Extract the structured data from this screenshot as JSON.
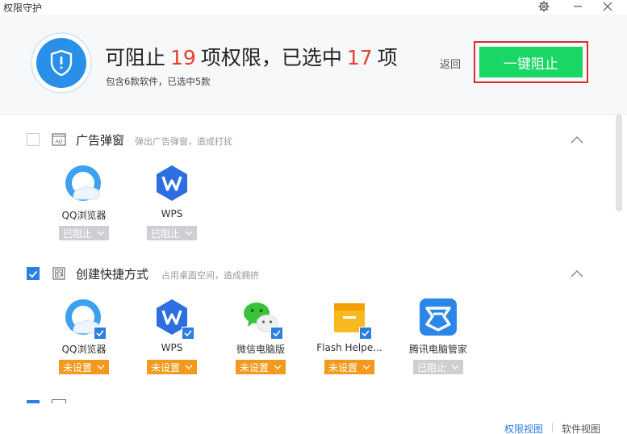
{
  "window": {
    "title": "权限守护"
  },
  "header": {
    "main_prefix": "可阻止",
    "blockable_count": "19",
    "main_middle": "项权限，已选中",
    "selected_count": "17",
    "main_suffix": "项",
    "subtitle": "包含6款软件，已选中5款",
    "back_label": "返回",
    "block_button": "一键阻止"
  },
  "categories": [
    {
      "title": "广告弹窗",
      "description": "弹出广告弹窗，造成打扰",
      "checked": false,
      "apps": [
        {
          "name": "QQ浏览器",
          "status": "已阻止",
          "icon": "qq-browser-icon"
        },
        {
          "name": "WPS",
          "status": "已阻止",
          "icon": "wps-icon"
        }
      ]
    },
    {
      "title": "创建快捷方式",
      "description": "占用桌面空间，造成拥挤",
      "checked": true,
      "apps": [
        {
          "name": "QQ浏览器",
          "status": "未设置",
          "icon": "qq-browser-icon"
        },
        {
          "name": "WPS",
          "status": "未设置",
          "icon": "wps-icon"
        },
        {
          "name": "微信电脑版",
          "status": "未设置",
          "icon": "wechat-icon"
        },
        {
          "name": "Flash Helpe...",
          "status": "未设置",
          "icon": "flash-helper-icon"
        },
        {
          "name": "腾讯电脑管家",
          "status": "已阻止",
          "icon": "tencent-pc-manager-icon"
        }
      ]
    }
  ],
  "footer": {
    "view_permissions": "权限视图",
    "view_software": "软件视图"
  },
  "colors": {
    "accent_blue": "#2a7fe0",
    "highlight_red": "#e8402f",
    "primary_green": "#19d665",
    "unset_orange": "#f39a1e",
    "blocked_gray": "#cdcfd3"
  }
}
